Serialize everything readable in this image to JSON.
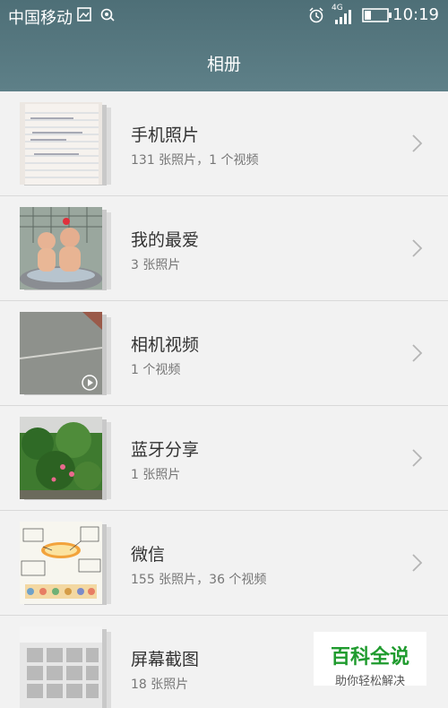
{
  "status_bar": {
    "carrier": "中国移动",
    "network": "4G",
    "time": "10:19"
  },
  "header": {
    "title": "相册"
  },
  "albums": [
    {
      "name": "手机照片",
      "count": "131 张照片，1 个视频"
    },
    {
      "name": "我的最爱",
      "count": "3 张照片"
    },
    {
      "name": "相机视频",
      "count": "1 个视频"
    },
    {
      "name": "蓝牙分享",
      "count": "1 张照片"
    },
    {
      "name": "微信",
      "count": "155 张照片，36 个视频"
    },
    {
      "name": "屏幕截图",
      "count": "18 张照片"
    }
  ],
  "watermark": {
    "title": "百科全说",
    "subtitle": "助你轻松解决"
  },
  "colors": {
    "header": "#577880",
    "background": "#f2f2f2",
    "watermark_green": "#1f9b2e"
  }
}
